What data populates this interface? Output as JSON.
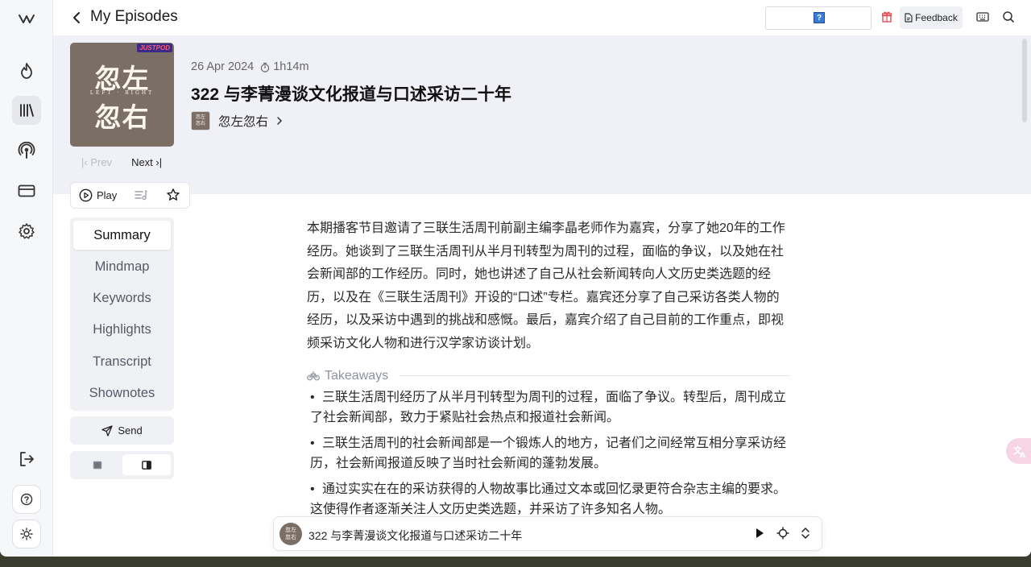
{
  "topbar": {
    "title": "My Episodes",
    "feedback_label": "Feedback",
    "search_glyph": "?"
  },
  "rail": {
    "icons": [
      "app-logo-icon",
      "flame-icon",
      "library-icon",
      "podcast-icon",
      "card-icon",
      "gear-icon",
      "logout-icon",
      "help-icon",
      "sun-icon"
    ]
  },
  "episode": {
    "date": "26 Apr 2024",
    "duration": "1h14m",
    "title": "322 与李菁漫谈文化报道与口述采访二十年",
    "podcast_name": "忽左忽右",
    "cover": {
      "line1": "忽左",
      "line2": "忽右",
      "subtitle": "LEFT · RIGHT",
      "badge": "JUSTPOD"
    },
    "prev_label": "Prev",
    "next_label": "Next"
  },
  "actions": {
    "play_label": "Play"
  },
  "tabs": [
    {
      "label": "Summary",
      "active": true
    },
    {
      "label": "Mindmap"
    },
    {
      "label": "Keywords"
    },
    {
      "label": "Highlights"
    },
    {
      "label": "Transcript"
    },
    {
      "label": "Shownotes"
    }
  ],
  "send_label": "Send",
  "summary_text": "本期播客节目邀请了三联生活周刊前副主编李晶老师作为嘉宾，分享了她20年的工作经历。她谈到了三联生活周刊从半月刊转型为周刊的过程，面临的争议，以及她在社会新闻部的工作经历。同时，她也讲述了自己从社会新闻转向人文历史类选题的经历，以及在《三联生活周刊》开设的“口述”专栏。嘉宾还分享了自己采访各类人物的经历，以及采访中遇到的挑战和感慨。最后，嘉宾介绍了自己目前的工作重点，即视频采访文化人物和进行汉学家访谈计划。",
  "takeaways": {
    "heading": "Takeaways",
    "items": [
      "三联生活周刊经历了从半月刊转型为周刊的过程，面临了争议。转型后，周刊成立了社会新闻部，致力于紧贴社会热点和报道社会新闻。",
      "三联生活周刊的社会新闻部是一个锻炼人的地方，记者们之间经常互相分享采访经历，社会新闻报道反映了当时社会新闻的蓬勃发展。",
      "通过实实在在的采访获得的人物故事比通过文本或回忆录更符合杂志主编的要求。这使得作者逐渐关注人文历史类选题，并采访了许多知名人物。"
    ]
  },
  "player": {
    "title": "322 与李菁漫谈文化报道与口述采访二十年",
    "cover_text": "忽左忽右"
  }
}
